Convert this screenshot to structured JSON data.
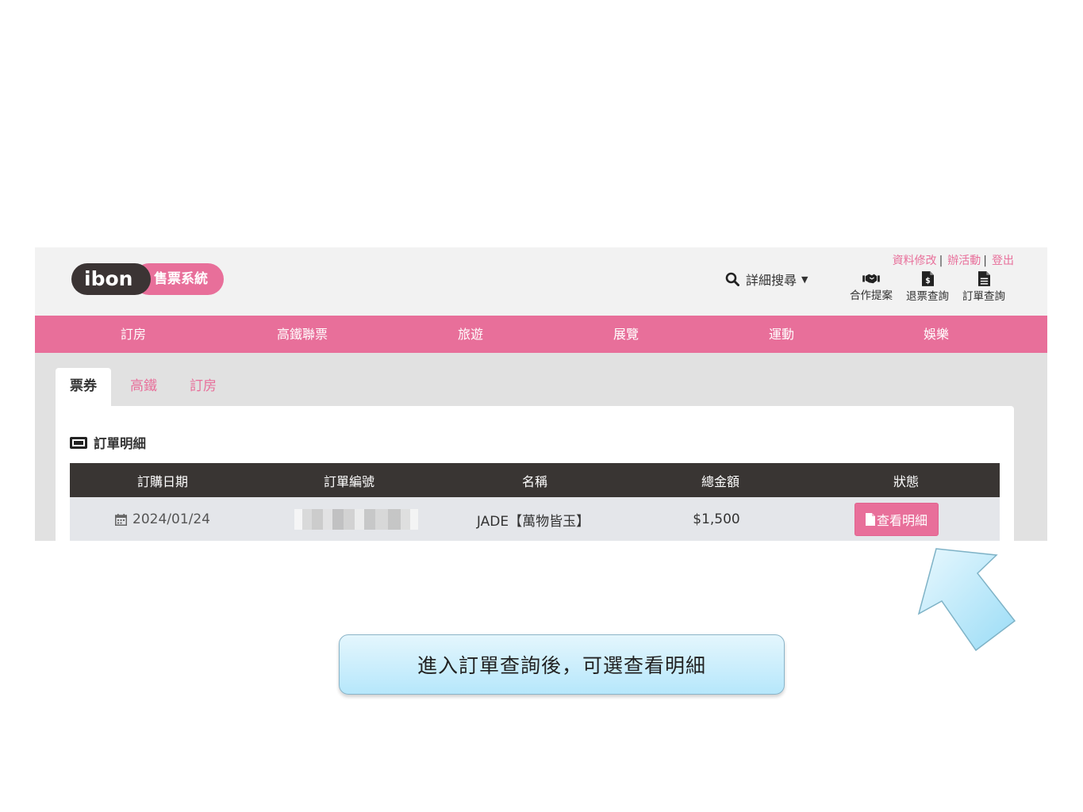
{
  "brand": {
    "logo_text": "ibon",
    "system_name": "售票系統"
  },
  "header": {
    "search_label": "詳細搜尋",
    "top_links": [
      "資料修改",
      "辦活動",
      "登出"
    ],
    "separator": "|",
    "quick_links": [
      {
        "icon": "handshake-icon",
        "label": "合作提案"
      },
      {
        "icon": "refund-document-icon",
        "label": "退票查詢"
      },
      {
        "icon": "document-icon",
        "label": "訂單查詢"
      }
    ]
  },
  "main_nav": [
    "訂房",
    "高鐵聯票",
    "旅遊",
    "展覽",
    "運動",
    "娛樂"
  ],
  "tabs": [
    {
      "label": "票券",
      "active": true
    },
    {
      "label": "高鐵",
      "active": false
    },
    {
      "label": "訂房",
      "active": false
    }
  ],
  "order_section": {
    "title": "訂單明細",
    "columns": [
      "訂購日期",
      "訂單編號",
      "名稱",
      "總金額",
      "狀態"
    ],
    "rows": [
      {
        "date": "2024/01/24",
        "order_no_redacted": true,
        "name": "JADE【萬物皆玉】",
        "amount": "$1,500",
        "action_label": "查看明細"
      }
    ]
  },
  "annotation": {
    "text": "進入訂單查詢後，可選查看明細"
  },
  "colors": {
    "brand_pink": "#e86f9a",
    "dark": "#393533",
    "logo_dark": "#3b3434",
    "callout_blue": "#b6e7fb"
  }
}
